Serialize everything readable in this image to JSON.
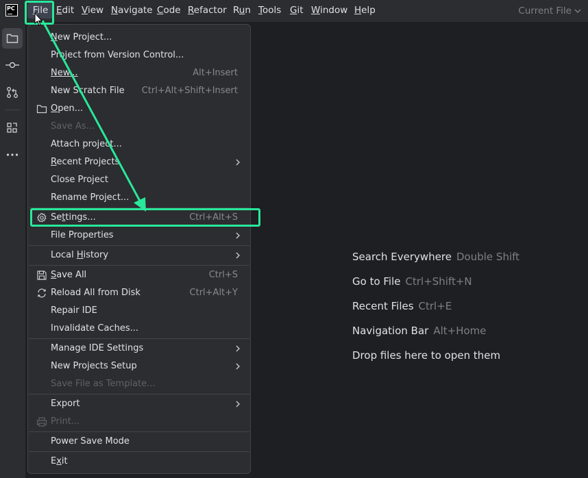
{
  "app": {
    "logo_text": "PC"
  },
  "menubar": {
    "items": [
      {
        "label": "File",
        "mnemonic": "F"
      },
      {
        "label": "Edit",
        "mnemonic": "E"
      },
      {
        "label": "View",
        "mnemonic": "V"
      },
      {
        "label": "Navigate",
        "mnemonic": "N"
      },
      {
        "label": "Code",
        "mnemonic": "C"
      },
      {
        "label": "Refactor",
        "mnemonic": "R"
      },
      {
        "label": "Run",
        "mnemonic": "u"
      },
      {
        "label": "Tools",
        "mnemonic": "T"
      },
      {
        "label": "Git",
        "mnemonic": "G"
      },
      {
        "label": "Window",
        "mnemonic": "W"
      },
      {
        "label": "Help",
        "mnemonic": "H"
      }
    ],
    "current_file": "Current File"
  },
  "toolstrip": {
    "buttons": [
      {
        "name": "project-icon",
        "active": true
      },
      {
        "name": "commit-icon"
      },
      {
        "name": "pull-requests-icon"
      },
      {
        "name": "structure-icon"
      },
      {
        "name": "more-icon"
      }
    ]
  },
  "file_menu": {
    "items": [
      {
        "label": "New Project...",
        "mnemonic": "",
        "shortcut": ""
      },
      {
        "label": "Project from Version Control...",
        "shortcut": ""
      },
      {
        "label": "New...",
        "shortcut": "Alt+Insert"
      },
      {
        "label": "New Scratch File",
        "shortcut": "Ctrl+Alt+Shift+Insert"
      },
      {
        "label": "Open...",
        "icon": "folder-icon",
        "shortcut": ""
      },
      {
        "label": "Save As...",
        "disabled": true,
        "shortcut": ""
      },
      {
        "label": "Attach project...",
        "shortcut": ""
      },
      {
        "label": "Recent Projects",
        "submenu": true
      },
      {
        "label": "Close Project",
        "shortcut": ""
      },
      {
        "label": "Rename Project...",
        "shortcut": ""
      },
      {
        "label": "Settings...",
        "icon": "gear-icon",
        "shortcut": "Ctrl+Alt+S"
      },
      {
        "label": "File Properties",
        "submenu": true
      },
      {
        "label": "Local History",
        "submenu": true
      },
      {
        "label": "Save All",
        "icon": "save-icon",
        "shortcut": "Ctrl+S"
      },
      {
        "label": "Reload All from Disk",
        "icon": "reload-icon",
        "shortcut": "Ctrl+Alt+Y"
      },
      {
        "label": "Repair IDE",
        "shortcut": ""
      },
      {
        "label": "Invalidate Caches...",
        "shortcut": ""
      },
      {
        "label": "Manage IDE Settings",
        "submenu": true
      },
      {
        "label": "New Projects Setup",
        "submenu": true
      },
      {
        "label": "Save File as Template...",
        "disabled": true
      },
      {
        "label": "Export",
        "submenu": true
      },
      {
        "label": "Print...",
        "icon": "print-icon",
        "disabled": true
      },
      {
        "label": "Power Save Mode",
        "shortcut": ""
      },
      {
        "label": "Exit",
        "shortcut": ""
      }
    ]
  },
  "empty_state": {
    "hints": [
      {
        "text": "Search Everywhere",
        "key": "Double Shift"
      },
      {
        "text": "Go to File",
        "key": "Ctrl+Shift+N"
      },
      {
        "text": "Recent Files",
        "key": "Ctrl+E"
      },
      {
        "text": "Navigation Bar",
        "key": "Alt+Home"
      },
      {
        "text": "Drop files here to open them",
        "key": ""
      }
    ]
  },
  "colors": {
    "background": "#1e1f22",
    "panel": "#2b2d30",
    "highlight": "#29e89a",
    "text": "#dfe1e5",
    "muted": "#868a91"
  }
}
